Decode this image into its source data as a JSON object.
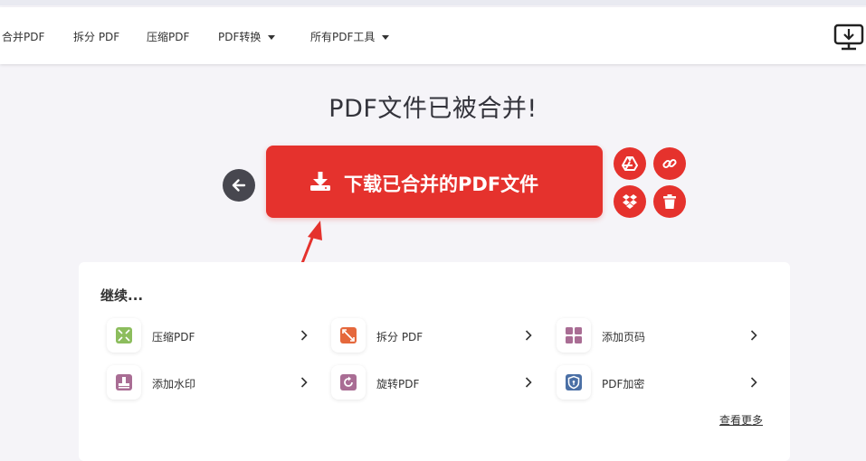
{
  "nav": {
    "items": [
      {
        "label": "合并PDF",
        "dropdown": false
      },
      {
        "label": "拆分 PDF",
        "dropdown": false
      },
      {
        "label": "压缩PDF",
        "dropdown": false
      },
      {
        "label": "PDF转换",
        "dropdown": true
      },
      {
        "label": "所有PDF工具",
        "dropdown": true
      }
    ],
    "desktop_icon": "desktop-download-icon"
  },
  "main": {
    "title": "PDF文件已被合并!",
    "download_label": "下载已合并的PDF文件",
    "icons": {
      "back": "arrow-left-icon",
      "download": "download-icon",
      "google_drive": "google-drive-icon",
      "link": "link-icon",
      "dropbox": "dropbox-icon",
      "delete": "trash-icon"
    }
  },
  "continue": {
    "label": "继续...",
    "tools": [
      {
        "label": "压缩PDF",
        "icon": "compress-icon",
        "color": "#8cbd5d"
      },
      {
        "label": "拆分 PDF",
        "icon": "split-icon",
        "color": "#e5683c"
      },
      {
        "label": "添加页码",
        "icon": "page-numbers-icon",
        "color": "#a96d94"
      },
      {
        "label": "添加水印",
        "icon": "watermark-icon",
        "color": "#a96d94"
      },
      {
        "label": "旋转PDF",
        "icon": "rotate-icon",
        "color": "#a96d94"
      },
      {
        "label": "PDF加密",
        "icon": "shield-icon",
        "color": "#4a6fa5"
      }
    ],
    "see_more": "查看更多"
  },
  "colors": {
    "accent": "#e5322d",
    "dark_button": "#47474f",
    "background": "#f5f4f8"
  }
}
